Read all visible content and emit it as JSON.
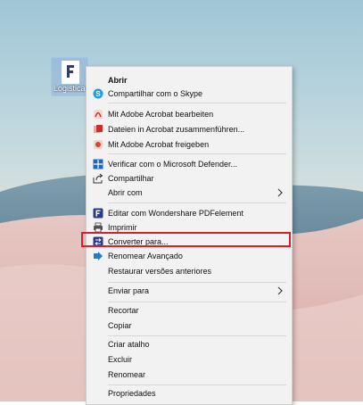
{
  "desktop": {
    "file_icon_label": "Logistica"
  },
  "context_menu": {
    "items": [
      {
        "label": "Abrir",
        "icon": "none",
        "bold": true
      },
      {
        "label": "Compartilhar com o Skype",
        "icon": "skype-icon"
      },
      {
        "label": "Mit Adobe Acrobat bearbeiten",
        "icon": "acrobat-edit-icon"
      },
      {
        "label": "Dateien in Acrobat zusammenführen...",
        "icon": "acrobat-combine-icon"
      },
      {
        "label": "Mit Adobe Acrobat freigeben",
        "icon": "acrobat-share-icon"
      },
      {
        "label": "Verificar com o Microsoft Defender...",
        "icon": "defender-icon"
      },
      {
        "label": "Compartilhar",
        "icon": "share-icon"
      },
      {
        "label": "Abrir com",
        "icon": "none",
        "submenu": true
      },
      {
        "label": "Editar com Wondershare PDFelement",
        "icon": "pdfelement-icon"
      },
      {
        "label": "Imprimir",
        "icon": "print-icon"
      },
      {
        "label": "Converter para...",
        "icon": "convert-icon",
        "highlighted": true
      },
      {
        "label": "Renomear Avançado",
        "icon": "rename-icon"
      },
      {
        "label": "Restaurar versões anteriores",
        "icon": "none"
      },
      {
        "label": "Enviar para",
        "icon": "none",
        "submenu": true
      },
      {
        "label": "Recortar",
        "icon": "none"
      },
      {
        "label": "Copiar",
        "icon": "none"
      },
      {
        "label": "Criar atalho",
        "icon": "none"
      },
      {
        "label": "Excluir",
        "icon": "none"
      },
      {
        "label": "Renomear",
        "icon": "none"
      },
      {
        "label": "Propriedades",
        "icon": "none"
      }
    ],
    "highlight_color": "#d8202a"
  }
}
